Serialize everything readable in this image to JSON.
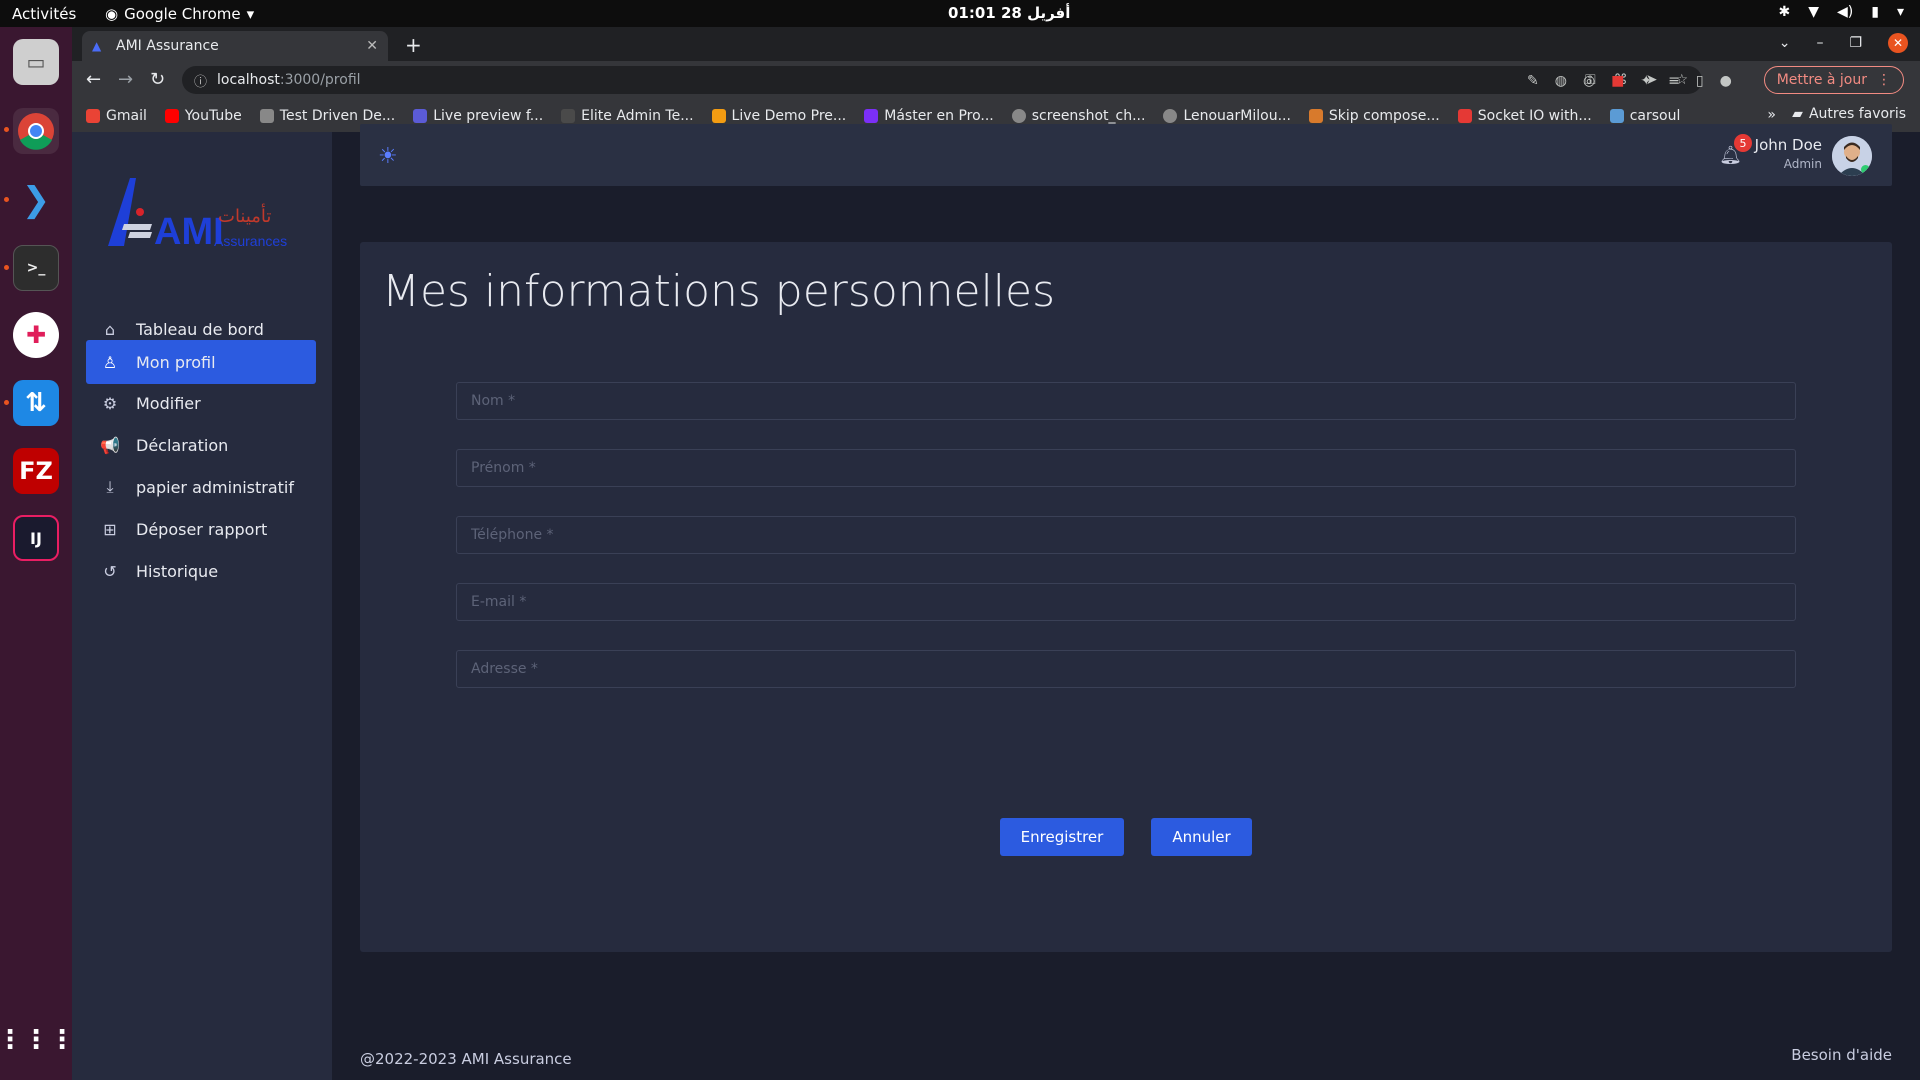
{
  "os": {
    "activities": "Activités",
    "app_name": "Google Chrome",
    "clock": "01:01  28 أفريل"
  },
  "browser": {
    "tab_title": "AMI Assurance",
    "url_host": "localhost",
    "url_path": ":3000/profil",
    "update_button": "Mettre à jour",
    "bookmarks": [
      {
        "label": "Gmail",
        "color": "#ea4335"
      },
      {
        "label": "YouTube",
        "color": "#ff0000"
      },
      {
        "label": "Test Driven De...",
        "color": "#888888"
      },
      {
        "label": "Live preview f...",
        "color": "#5b5bd6"
      },
      {
        "label": "Elite Admin Te...",
        "color": "#4a4a4a"
      },
      {
        "label": "Live Demo Pre...",
        "color": "#f39c12"
      },
      {
        "label": "Máster en Pro...",
        "color": "#7b2ff7"
      },
      {
        "label": "screenshot_ch...",
        "color": "#888888"
      },
      {
        "label": "LenouarMilou...",
        "color": "#888888"
      },
      {
        "label": "Skip compose...",
        "color": "#d87a2c"
      },
      {
        "label": "Socket IO with...",
        "color": "#e53935"
      },
      {
        "label": "carsoul",
        "color": "#5b9bd5"
      }
    ],
    "other_bookmarks": "Autres favoris"
  },
  "sidebar": {
    "logo_text": "AMI",
    "logo_subtext": "Assurances",
    "logo_arabic": "تأمينات",
    "items": [
      {
        "label": "Tableau de bord",
        "icon": "home-icon"
      },
      {
        "label": "Mon profil",
        "icon": "user-icon",
        "active": true
      },
      {
        "label": "Modifier",
        "icon": "gear-icon"
      },
      {
        "label": "Déclaration",
        "icon": "megaphone-icon"
      },
      {
        "label": "papier administratif",
        "icon": "download-icon"
      },
      {
        "label": "Déposer rapport",
        "icon": "folder-plus-icon"
      },
      {
        "label": "Historique",
        "icon": "history-icon"
      }
    ]
  },
  "header": {
    "notification_count": "5",
    "user_name": "John Doe",
    "user_role": "Admin"
  },
  "form": {
    "title": "Mes informations personnelles",
    "fields": {
      "nom": "Nom *",
      "prenom": "Prénom *",
      "telephone": "Téléphone *",
      "email": "E-mail *",
      "adresse": "Adresse *"
    },
    "save_label": "Enregistrer",
    "cancel_label": "Annuler"
  },
  "footer": {
    "copyright": "@2022-2023 AMI Assurance",
    "help": "Besoin d'aide"
  },
  "colors": {
    "accent": "#2c5be0",
    "sidebar_bg": "#262b3e",
    "page_bg": "#1a1d2b"
  }
}
